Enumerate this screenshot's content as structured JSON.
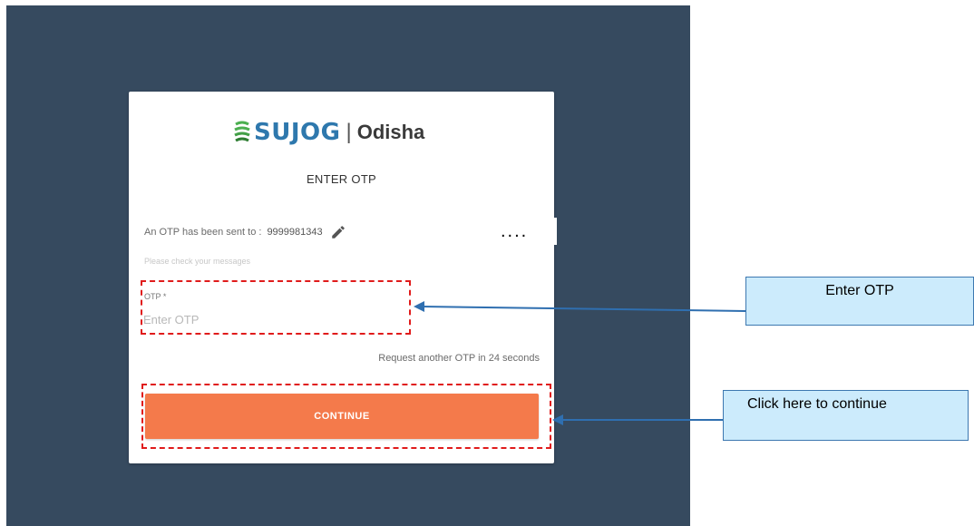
{
  "brand": {
    "name": "SUJOG",
    "separator": "|",
    "place": "Odisha",
    "colors": {
      "brand": "#2e78ad",
      "mark": "#4caf50"
    }
  },
  "otp_screen": {
    "heading": "ENTER OTP",
    "sent_text": "An OTP has been sent to :",
    "phone": "9999981343",
    "masked_dots": "....",
    "check_hint": "Please check your messages",
    "otp_label": "OTP *",
    "otp_placeholder": "Enter OTP",
    "otp_value": "",
    "resend_text": "Request another OTP in 24 seconds",
    "continue_label": "CONTINUE",
    "continue_color": "#f47a4b"
  },
  "annotations": {
    "enter_otp": "Enter OTP",
    "continue": "Click here to continue",
    "highlight_color": "#e01b1b",
    "callout_color": "#ccebfc"
  }
}
